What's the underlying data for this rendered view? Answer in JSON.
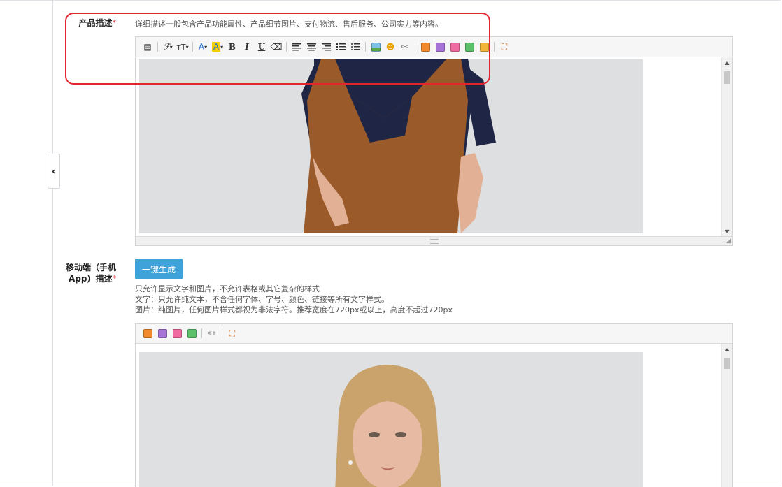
{
  "product_desc": {
    "label": "产品描述",
    "required_mark": "*",
    "hint": "详细描述一般包含产品功能属性、产品细节图片、支付物流、售后服务、公司实力等内容。"
  },
  "mobile_desc": {
    "label_line1": "移动端（手机",
    "label_line2": "App）描述",
    "required_mark": "*",
    "generate_button": "一键生成",
    "hints": [
      "只允许显示文字和图片，不允许表格或其它复杂的样式",
      "文字：只允许纯文本，不含任何字体、字号、颜色、链接等所有文字样式。",
      "图片：纯图片，任何图片样式都视为非法字符。推荐宽度在720px或以上，高度不超过720px"
    ]
  },
  "toolbar_glyphs": {
    "source": "▤",
    "font_family": "ℱ",
    "font_size": "ᴛT",
    "font_color": "A",
    "bg_color": "A",
    "bold": "B",
    "italic": "I",
    "underline": "U",
    "eraser": "⌫",
    "dropdown": "▾",
    "emoji": "☻",
    "link": "⚯",
    "fullscreen": "⛶",
    "scroll_up": "▲",
    "scroll_down": "▼",
    "corner": "◢"
  },
  "colors": {
    "accent_button": "#3fa2d8",
    "highlight_border": "#e3262d",
    "required": "#e4393c"
  }
}
